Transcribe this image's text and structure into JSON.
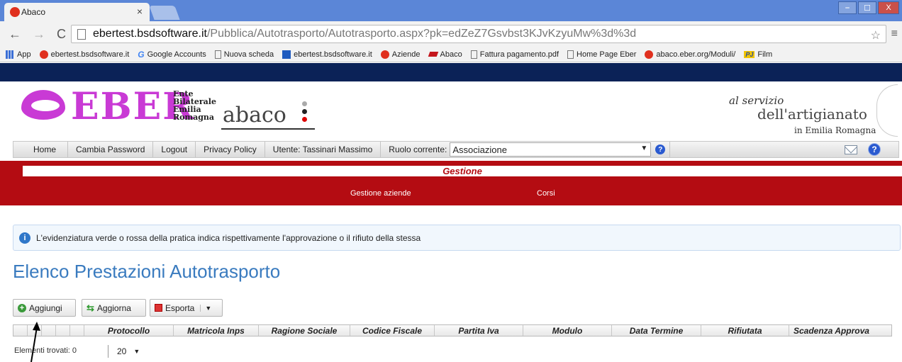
{
  "browser": {
    "tab_title": "Abaco",
    "tab_close": "×",
    "url_host": "ebertest.bsdsoftware.it",
    "url_path": "/Pubblica/Autotrasporto/Autotrasporto.aspx?pk=edZeZ7Gsvbst3KJvKzyuMw%3d%3d",
    "window_controls": [
      "⎯",
      "☐",
      "X"
    ]
  },
  "bookmarks": [
    {
      "label": "App",
      "icon": "apps-icon"
    },
    {
      "label": "ebertest.bsdsoftware.it",
      "icon": "eber-icon"
    },
    {
      "label": "Google Accounts",
      "icon": "google-icon"
    },
    {
      "label": "Nuova scheda",
      "icon": "page-icon"
    },
    {
      "label": "ebertest.bsdsoftware.it",
      "icon": "blue-site-icon"
    },
    {
      "label": "Aziende",
      "icon": "eber-icon"
    },
    {
      "label": "Abaco",
      "icon": "abaco-icon"
    },
    {
      "label": "Fattura pagamento.pdf",
      "icon": "page-icon"
    },
    {
      "label": "Home Page Eber",
      "icon": "page-icon"
    },
    {
      "label": "abaco.eber.org/Moduli/",
      "icon": "eber-icon"
    },
    {
      "label": "Film",
      "icon": "pj-icon"
    }
  ],
  "header": {
    "logo_text": "EBER",
    "logo_sub": [
      "Ente",
      "Bilaterale",
      "Emilia",
      "Romagna"
    ],
    "abaco": "abaco",
    "tagline1": "al servizio",
    "tagline2": "dell'artigianato",
    "tagline3": "in Emilia Romagna"
  },
  "nav": {
    "home": "Home",
    "change_password": "Cambia Password",
    "logout": "Logout",
    "privacy": "Privacy Policy",
    "user": "Utente: Tassinari Massimo",
    "role_label": "Ruolo corrente:",
    "role_value": "Associazione"
  },
  "menu": {
    "section": "Gestione",
    "items": [
      "Gestione aziende",
      "Corsi"
    ]
  },
  "info_message": "L'evidenziatura verde o rossa della pratica indica rispettivamente l'approvazione o il rifiuto della stessa",
  "page_title": "Elenco Prestazioni Autotrasporto",
  "toolbar": {
    "add": "Aggiungi",
    "refresh": "Aggiorna",
    "export": "Esporta"
  },
  "grid": {
    "columns": [
      "Protocollo",
      "Matricola Inps",
      "Ragione Sociale",
      "Codice Fiscale",
      "Partita Iva",
      "Modulo",
      "Data Termine",
      "Rifiutata",
      "Scadenza Approva"
    ],
    "found_label": "Elementi trovati: 0",
    "page_size": "20"
  },
  "colors": {
    "brand_purple": "#c93ad5",
    "menu_red": "#b40c12",
    "title_blue": "#3a7bbf",
    "header_navy": "#0b2257"
  }
}
